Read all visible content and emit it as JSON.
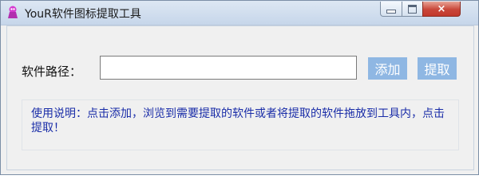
{
  "window": {
    "title": "YouR软件图标提取工具",
    "controls": {
      "minimize": "minimize",
      "maximize": "maximize",
      "close": "×"
    }
  },
  "form": {
    "path_label": "软件路径：",
    "path_value": "",
    "add_button": "添加",
    "extract_button": "提取"
  },
  "instructions": {
    "text": "使用说明：点击添加，浏览到需要提取的软件或者将提取的软件拖放到工具内，点击提取！"
  },
  "colors": {
    "button_bg": "#8fb7e3",
    "instruction_text": "#1a2da8",
    "close_button": "#c9473a"
  },
  "icons": {
    "app": "app-logo-icon"
  }
}
